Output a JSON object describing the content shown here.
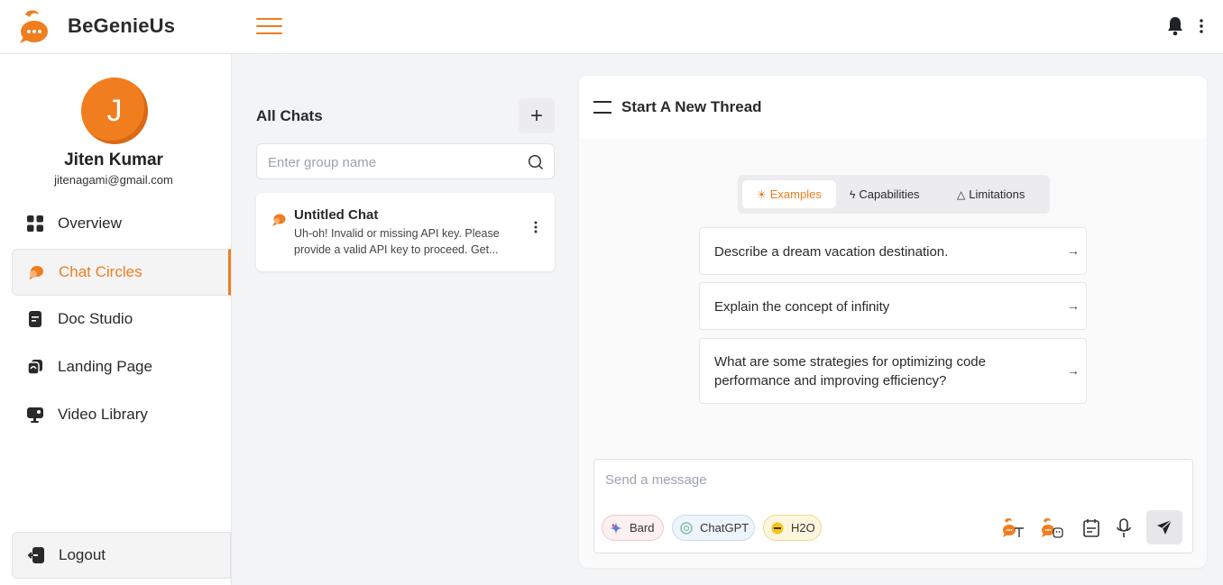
{
  "app": {
    "brand": "BeGenieUs",
    "accent": "#f07d1e"
  },
  "user": {
    "initial": "J",
    "name": "Jiten Kumar",
    "email": "jitenagami@gmail.com"
  },
  "nav": [
    {
      "label": "Overview",
      "icon": "grid-icon",
      "active": false
    },
    {
      "label": "Chat Circles",
      "icon": "chat-bubbles-icon",
      "active": true
    },
    {
      "label": "Doc Studio",
      "icon": "document-icon",
      "active": false
    },
    {
      "label": "Landing Page",
      "icon": "pages-icon",
      "active": false
    },
    {
      "label": "Video Library",
      "icon": "monitor-icon",
      "active": false
    }
  ],
  "logout": {
    "label": "Logout",
    "icon": "logout-icon"
  },
  "chats": {
    "title": "All Chats",
    "add_label": "+",
    "search_placeholder": "Enter group name",
    "items": [
      {
        "title": "Untitled Chat",
        "snippet": "Uh-oh! Invalid or missing API key. Please provide a valid API key to proceed. Get..."
      }
    ]
  },
  "thread": {
    "title": "Start A New Thread",
    "tabs": [
      {
        "label": "Examples",
        "icon": "sun-icon",
        "active": true
      },
      {
        "label": "Capabilities",
        "icon": "bolt-icon",
        "active": false
      },
      {
        "label": "Limitations",
        "icon": "warning-icon",
        "active": false
      }
    ],
    "examples": [
      {
        "text": "Describe a dream vacation destination.",
        "arrow": "→"
      },
      {
        "text": "Explain the concept of infinity",
        "arrow": "→"
      },
      {
        "text": "What are some strategies for optimizing code performance and improving efficiency?",
        "arrow": "→"
      }
    ]
  },
  "composer": {
    "placeholder": "Send a message",
    "models": [
      {
        "label": "Bard",
        "icon": "bard-icon",
        "bg": "#fdf0f0",
        "border": "#f3c9c9"
      },
      {
        "label": "ChatGPT",
        "icon": "chatgpt-icon",
        "bg": "#eef4fb",
        "border": "#c7dcf1"
      },
      {
        "label": "H2O",
        "icon": "h2o-icon",
        "bg": "#fdf6de",
        "border": "#f0d98a"
      }
    ]
  }
}
